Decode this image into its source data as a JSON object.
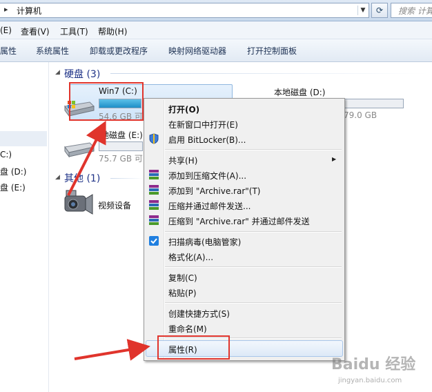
{
  "address_bar": {
    "arrow": "▸",
    "path": "计算机",
    "dropdown": "▼",
    "refresh": "⟳",
    "search_placeholder": "搜索 计算机"
  },
  "menu_bar": {
    "items": [
      "(E)",
      "查看(V)",
      "工具(T)",
      "帮助(H)"
    ]
  },
  "command_bar": {
    "items": [
      "属性",
      "系统属性",
      "卸载或更改程序",
      "映射网络驱动器",
      "打开控制面板"
    ]
  },
  "nav_pane": {
    "items": [
      "C:)",
      "盘 (D:)",
      "盘 (E:)"
    ]
  },
  "groups": {
    "hard_disks": {
      "title": "硬盘 (3)"
    },
    "other": {
      "title": "其他 (1)"
    }
  },
  "drives": {
    "c": {
      "name": "Win7 (C:)",
      "free": "54.6 GB 可",
      "fill_percent": 100
    },
    "d": {
      "name": "本地磁盘 (D:)",
      "free": "79.0 GB",
      "fill_percent": 0
    },
    "e": {
      "name": "地磁盘 (E:)",
      "free": "75.7 GB 可",
      "fill_percent": 0
    }
  },
  "devices": {
    "camera": {
      "name": "视频设备"
    }
  },
  "context_menu": {
    "open": "打开(O)",
    "open_new_window": "在新窗口中打开(E)",
    "bitlocker": "启用 BitLocker(B)...",
    "share": "共享(H)",
    "add_to_archive": "添加到压缩文件(A)...",
    "add_to_rar": "添加到 \"Archive.rar\"(T)",
    "compress_email": "压缩并通过邮件发送...",
    "compress_rar_email": "压缩到 \"Archive.rar\" 并通过邮件发送",
    "scan_virus": "扫描病毒(电脑管家)",
    "format": "格式化(A)...",
    "copy": "复制(C)",
    "paste": "粘贴(P)",
    "create_shortcut": "创建快捷方式(S)",
    "rename": "重命名(M)",
    "properties": "属性(R)",
    "submenu_arrow": "▶"
  },
  "watermark": {
    "text": "Baidu 经验",
    "url": "jingyan.baidu.com"
  },
  "colors": {
    "accent": "#1e8fc7",
    "annotation": "#e0342c",
    "group_title": "#1e3287"
  }
}
